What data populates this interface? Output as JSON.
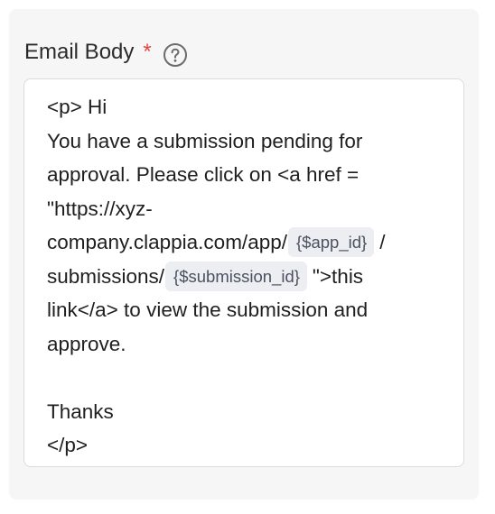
{
  "field": {
    "label": "Email Body",
    "required_marker": "*"
  },
  "help_icon": {
    "name": "question-circle-icon",
    "color": "#6b6b6b"
  },
  "editor": {
    "lines": {
      "l1": "<p> Hi",
      "l2": "You have a submission pending for",
      "l3": "approval. Please click on <a href =",
      "l4": "\"https://xyz-",
      "l5_before": "company.clappia.com/app/",
      "l5_chip": "{$app_id}",
      "l5_after": "/",
      "l6_before": "submissions/",
      "l6_chip": "{$submission_id}",
      "l6_after": "\">this",
      "l7": "link</a> to view the submission and",
      "l8": "approve.",
      "l10": "Thanks",
      "l11": "</p>"
    }
  },
  "colors": {
    "required": "#e2443a",
    "chip_bg": "#eceef1",
    "card_bg": "#f6f6f7"
  }
}
